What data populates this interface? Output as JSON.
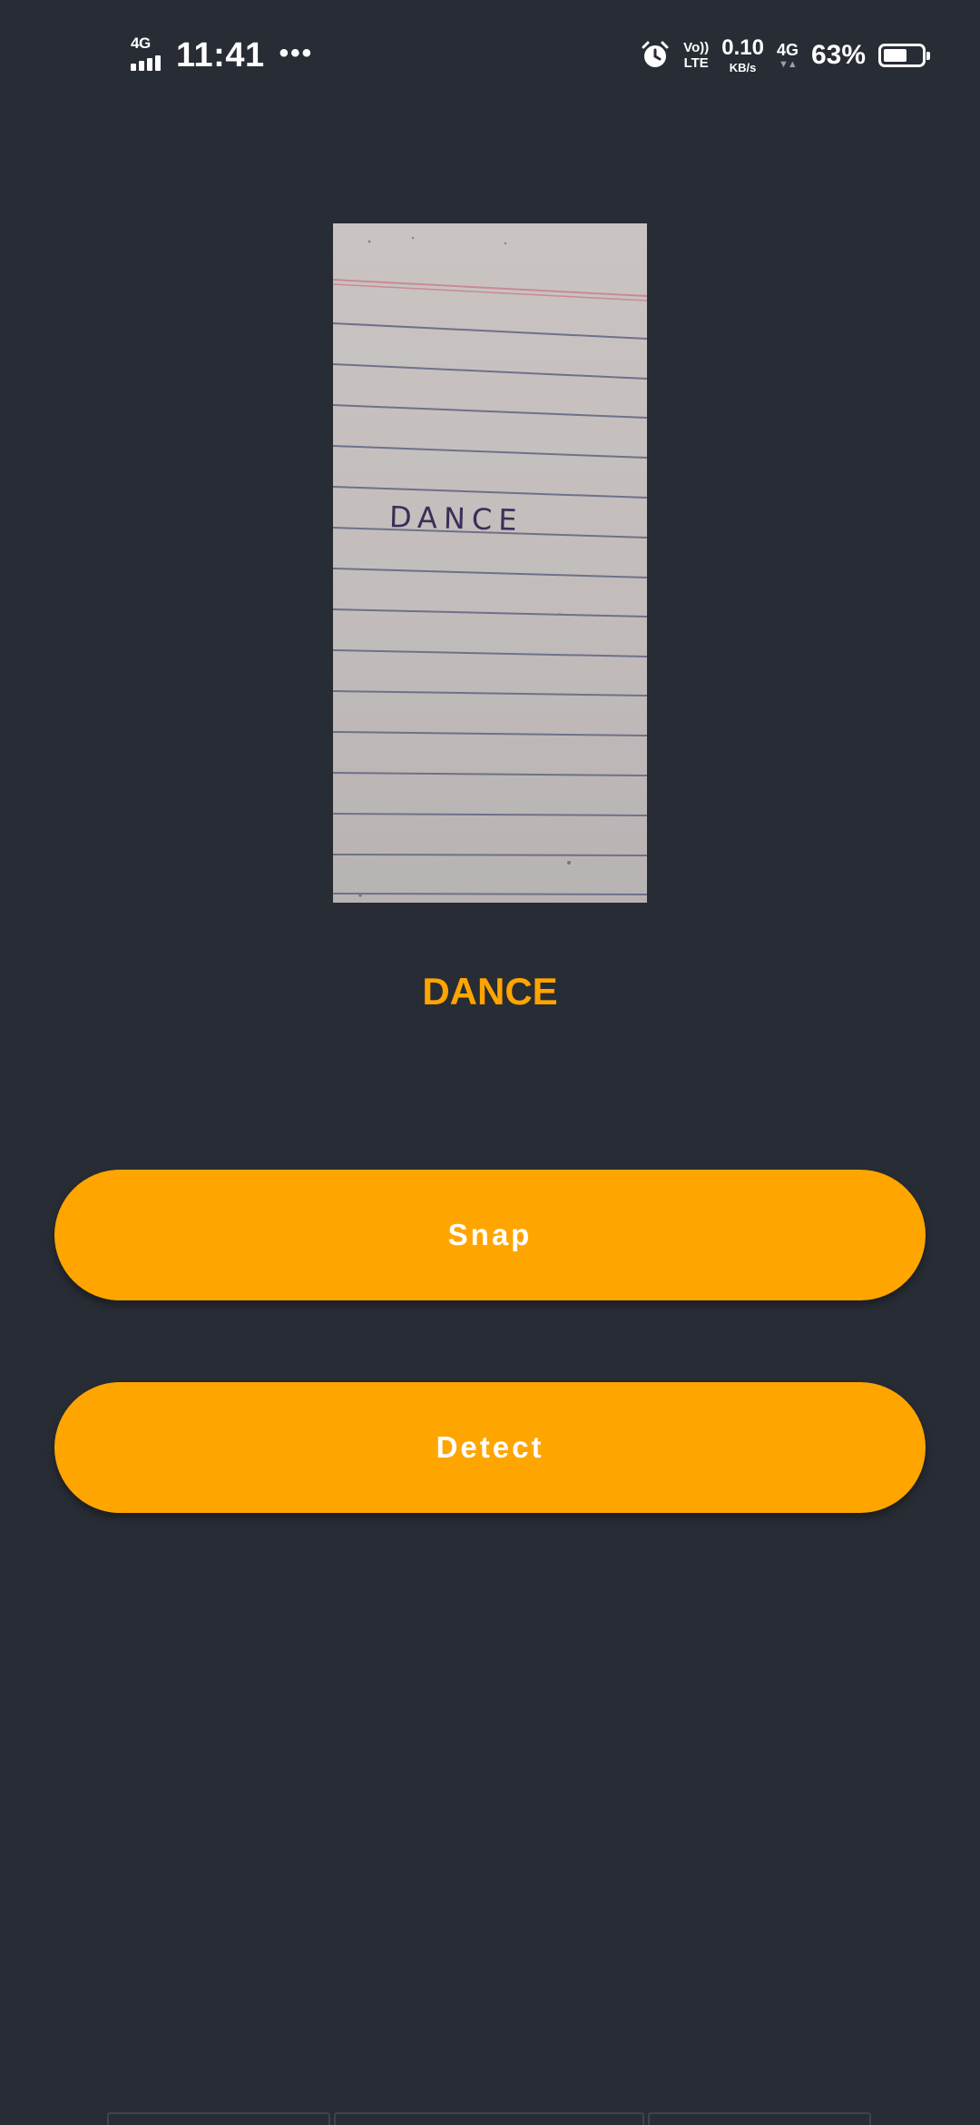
{
  "status_bar": {
    "network_type": "4G",
    "time": "11:41",
    "more": "•••",
    "volte_top": "Vo))",
    "volte_bottom": "LTE",
    "speed_value": "0.10",
    "speed_unit": "KB/s",
    "network_type_2": "4G",
    "battery_text": "63%",
    "battery_level": 0.63,
    "icons": [
      "signal-icon",
      "alarm-icon",
      "volte-icon",
      "data-arrows-icon",
      "battery-icon"
    ]
  },
  "preview": {
    "handwritten_text": "DANCE"
  },
  "result": {
    "text": "DANCE"
  },
  "buttons": {
    "snap_label": "Snap",
    "detect_label": "Detect"
  },
  "colors": {
    "background": "#282c34",
    "accent": "#ffa500",
    "button_text": "#ffffff"
  }
}
